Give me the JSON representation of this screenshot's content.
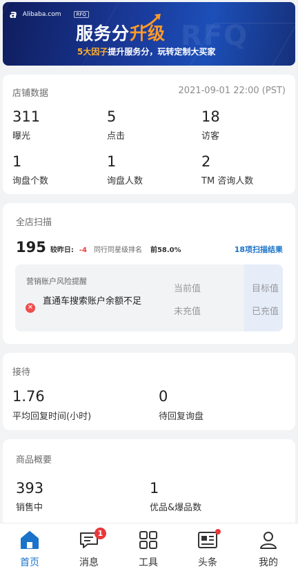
{
  "banner": {
    "logo_mark": "a",
    "logo_text": "Alibaba.com",
    "rfq_tag": "RFQ",
    "headline_main": "服务分",
    "headline_accent": "升级",
    "ghost_text": "RFQ",
    "sub_accent": "5大因子",
    "sub_text": "提升服务分，玩转定制大买家"
  },
  "store_data": {
    "title": "店铺数据",
    "timestamp": "2021-09-01 22:00 (PST)",
    "stats": [
      {
        "value": "311",
        "label": "曝光"
      },
      {
        "value": "5",
        "label": "点击"
      },
      {
        "value": "18",
        "label": "访客"
      },
      {
        "value": "1",
        "label": "询盘个数"
      },
      {
        "value": "1",
        "label": "询盘人数"
      },
      {
        "value": "2",
        "label": "TM 咨询人数"
      }
    ]
  },
  "scan": {
    "title": "全店扫描",
    "score": "195",
    "compare_label": "较昨日:",
    "delta": "-4",
    "rank_label": "同行同星级排名",
    "rank_value": "前58.0%",
    "results_link": "18项扫描结果",
    "risk": {
      "title": "营销账户风险提醒",
      "col_current": "当前值",
      "col_target": "目标值",
      "item_text": "直通车搜索账户余额不足",
      "current_value": "未充值",
      "target_value": "已充值"
    }
  },
  "reception": {
    "title": "接待",
    "stats": [
      {
        "value": "1.76",
        "label": "平均回复时间(小时)"
      },
      {
        "value": "0",
        "label": "待回复询盘"
      }
    ]
  },
  "products": {
    "title": "商品概要",
    "stats": [
      {
        "value": "393",
        "label": "销售中"
      },
      {
        "value": "1",
        "label": "优品&爆品数"
      }
    ]
  },
  "tabbar": {
    "items": [
      {
        "label": "首页",
        "icon": "home-icon",
        "active": true
      },
      {
        "label": "消息",
        "icon": "message-icon",
        "badge": "1"
      },
      {
        "label": "工具",
        "icon": "grid-icon"
      },
      {
        "label": "头条",
        "icon": "news-icon",
        "dot": true
      },
      {
        "label": "我的",
        "icon": "user-icon"
      }
    ]
  },
  "colors": {
    "accent_blue": "#1a73c9",
    "alert_red": "#e8383a",
    "banner_orange": "#ff9a2a"
  }
}
